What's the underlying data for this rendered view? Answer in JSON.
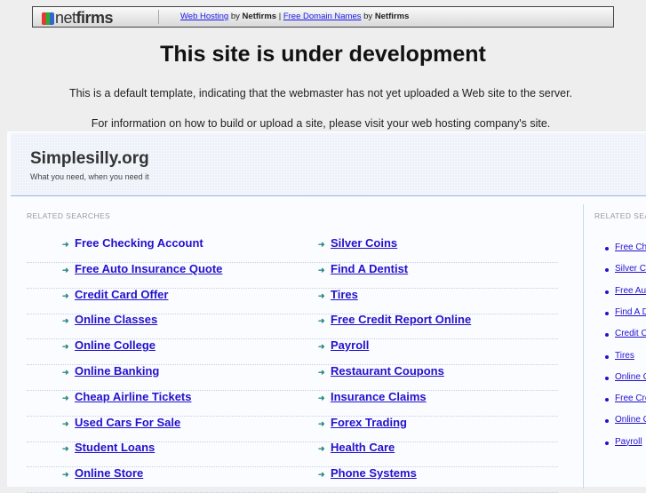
{
  "topbar": {
    "logo_text_a": "net",
    "logo_text_b": "firms",
    "link1": "Web Hosting",
    "by1": "by",
    "brand1": "Netfirms",
    "sep": "|",
    "link2": "Free Domain Names",
    "by2": "by",
    "brand2": "Netfirms"
  },
  "heading": "This site is under development",
  "message1": "This is a default template, indicating that the webmaster has not yet uploaded a Web site to the server.",
  "message2": "For information on how to build or upload a site, please visit your web hosting company's site.",
  "site": {
    "title": "Simplesilly.org",
    "tagline": "What you need, when you need it"
  },
  "related_label": "RELATED SEARCHES",
  "left_col": [
    "Free Checking Account",
    "Free Auto Insurance Quote",
    "Credit Card Offer",
    "Online Classes",
    "Online College",
    "Online Banking",
    "Cheap Airline Tickets",
    "Used Cars For Sale",
    "Student Loans",
    "Online Store"
  ],
  "right_col": [
    "Silver Coins",
    "Find A Dentist",
    "Tires",
    "Free Credit Report Online",
    "Payroll",
    "Restaurant Coupons",
    "Insurance Claims",
    "Forex Trading",
    "Health Care",
    "Phone Systems"
  ],
  "sidebar_label": "RELATED SEARCHES",
  "sidebar": [
    "Free Checking Account",
    "Silver Coins",
    "Free Auto Insurance Quote",
    "Find A Dentist",
    "Credit Card Offer",
    "Tires",
    "Online Classes",
    "Free Credit Report Online",
    "Online College",
    "Payroll"
  ]
}
